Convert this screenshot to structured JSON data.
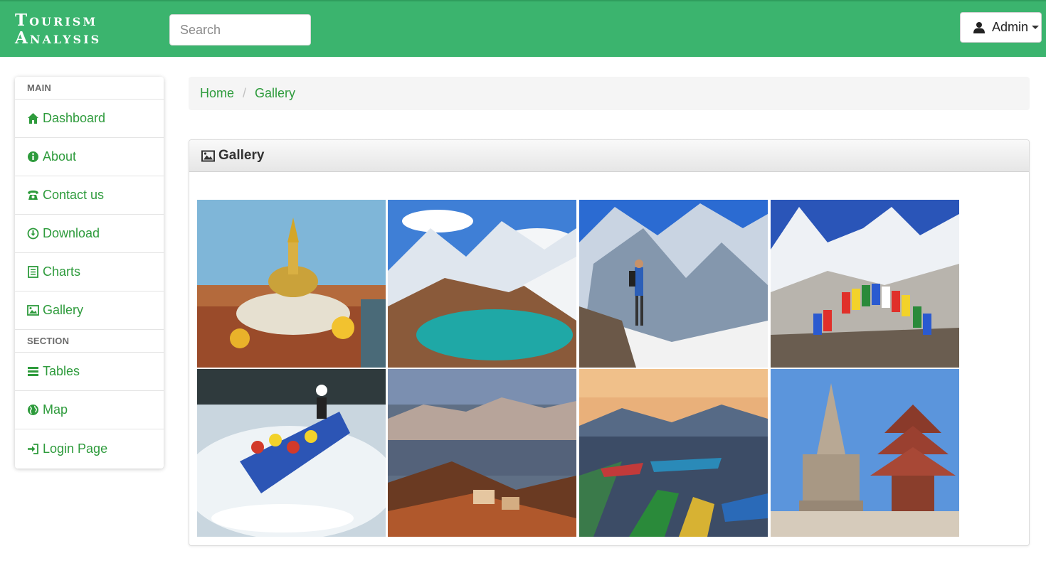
{
  "header": {
    "brand_line1": "Tourism",
    "brand_line2": "Analysis",
    "search_placeholder": "Search",
    "user_label": "Admin"
  },
  "sidebar": {
    "sections": [
      {
        "title": "MAIN",
        "items": [
          {
            "label": "Dashboard",
            "icon": "home-icon"
          },
          {
            "label": "About",
            "icon": "info-icon"
          },
          {
            "label": "Contact us",
            "icon": "phone-icon"
          },
          {
            "label": "Download",
            "icon": "download-icon"
          },
          {
            "label": "Charts",
            "icon": "list-doc-icon"
          },
          {
            "label": "Gallery",
            "icon": "picture-icon"
          }
        ]
      },
      {
        "title": "SECTION",
        "items": [
          {
            "label": "Tables",
            "icon": "table-icon"
          },
          {
            "label": "Map",
            "icon": "globe-icon"
          },
          {
            "label": "Login Page",
            "icon": "login-icon"
          }
        ]
      }
    ]
  },
  "breadcrumb": [
    "Home",
    "Gallery"
  ],
  "panel": {
    "title": "Gallery",
    "icon": "picture-icon"
  },
  "gallery": [
    {
      "subject": "stupa"
    },
    {
      "subject": "turquoise-lake"
    },
    {
      "subject": "hiker-snow-mountains"
    },
    {
      "subject": "prayer-flags"
    },
    {
      "subject": "river-rafting"
    },
    {
      "subject": "hill-town-sunset"
    },
    {
      "subject": "lake-boats"
    },
    {
      "subject": "temple-square"
    }
  ],
  "colors": {
    "header_green": "#3bb46e",
    "link_green": "#2e9b3c"
  }
}
